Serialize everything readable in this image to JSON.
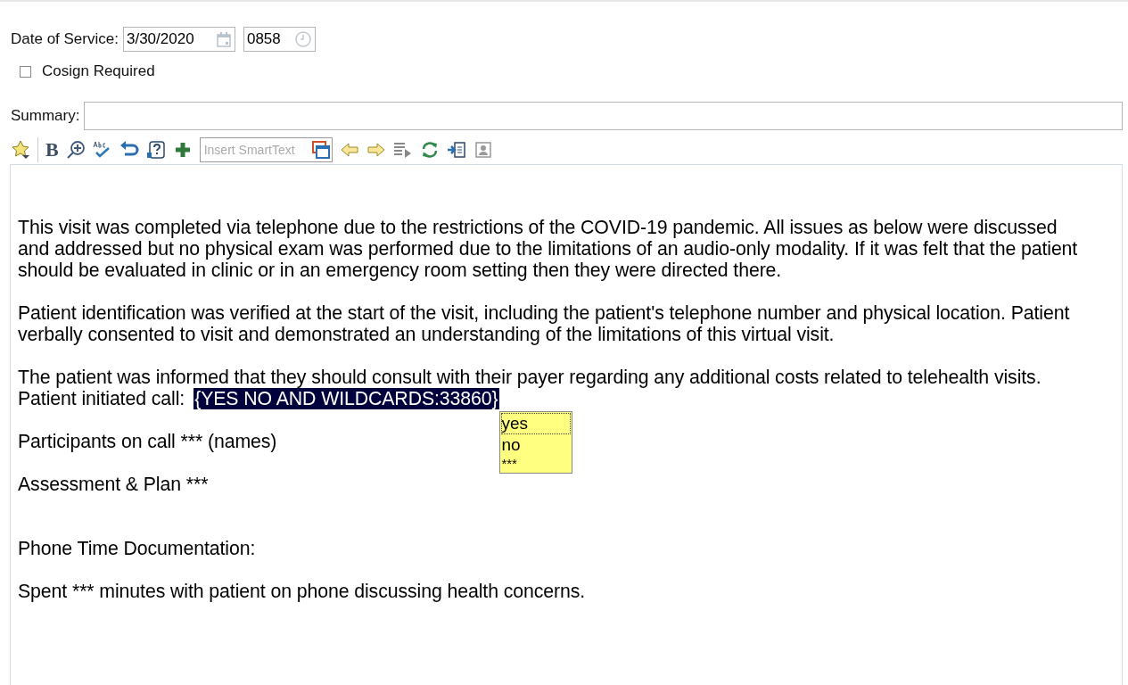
{
  "date_of_service": {
    "label": "Date of Service:",
    "date": "3/30/2020",
    "time": "0858"
  },
  "cosign": {
    "label": "Cosign Required",
    "checked": false
  },
  "summary": {
    "label": "Summary:"
  },
  "toolbar": {
    "bold_label": "B",
    "smarttext_placeholder": "Insert SmartText"
  },
  "note": [
    {
      "kind": "text",
      "text": "This visit was completed via telephone due to the restrictions of the COVID-19 pandemic. All issues as below were discussed and addressed but no physical exam was performed due to the limitations of an audio-only modality. If it was felt that the patient should be evaluated in clinic or in an emergency room setting then they were directed there."
    },
    {
      "kind": "text",
      "text": "Patient identification was verified at the start of the visit, including the patient's telephone number and physical location. Patient verbally consented to visit and demonstrated an understanding of the limitations of this virtual visit."
    },
    {
      "kind": "text",
      "text": "The patient was informed that they should consult with their payer regarding any additional costs related to telehealth visits."
    },
    {
      "kind": "field",
      "text": "Patient initiated call:",
      "field": "{YES NO AND WILDCARDS:33860}",
      "options": [
        {
          "label": "yes",
          "selected": true
        },
        {
          "label": "no",
          "selected": false
        },
        {
          "label": "***",
          "selected": false
        }
      ]
    },
    {
      "kind": "text",
      "text": "Participants on call *** (names)"
    },
    {
      "kind": "text",
      "text": "Assessment & Plan ***"
    },
    {
      "kind": "section",
      "text": "Phone Time Documentation:"
    },
    {
      "kind": "text",
      "text": "Spent *** minutes with patient on phone discussing health concerns."
    }
  ]
}
